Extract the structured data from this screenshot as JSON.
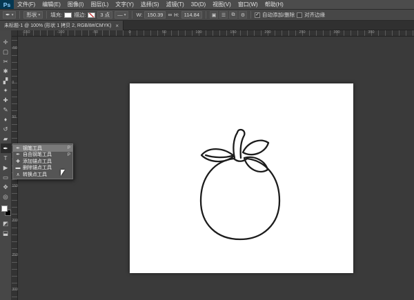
{
  "app": {
    "logo": "Ps",
    "menus": [
      {
        "label": "文件(F)"
      },
      {
        "label": "编辑(E)"
      },
      {
        "label": "图像(I)"
      },
      {
        "label": "图层(L)"
      },
      {
        "label": "文字(Y)"
      },
      {
        "label": "选择(S)"
      },
      {
        "label": "滤镜(T)"
      },
      {
        "label": "3D(D)"
      },
      {
        "label": "视图(V)"
      },
      {
        "label": "窗口(W)"
      },
      {
        "label": "帮助(H)"
      }
    ]
  },
  "icons": {
    "caret_down": "▾",
    "check": "✓",
    "close": "×",
    "link": "∞",
    "line_sample": "—"
  },
  "options": {
    "tool_icon": "✒",
    "mode": "形状",
    "fill_label": "填充:",
    "stroke_label": "描边:",
    "stroke_width": "3 点",
    "w_label": "W:",
    "w_value": "150.39",
    "h_label": "H:",
    "h_value": "114.84",
    "auto_add_delete": "自动添加/删除",
    "align_edges": "对齐边缘",
    "op_icons": [
      {
        "name": "path-operations-icon",
        "glyph": "▣"
      },
      {
        "name": "path-alignment-icon",
        "glyph": "☰"
      },
      {
        "name": "path-arrangement-icon",
        "glyph": "⧉"
      },
      {
        "name": "tool-settings-gear-icon",
        "glyph": "⚙"
      }
    ]
  },
  "tab": {
    "title": "未标题-1 @ 100% (形状 1 拷贝 2, RGB/8#/CMYK)",
    "close": "×"
  },
  "toolbar": {
    "tools": [
      {
        "name": "move-tool",
        "glyph": "✛"
      },
      {
        "name": "marquee-tool",
        "glyph": "▢"
      },
      {
        "name": "lasso-tool",
        "glyph": "✂"
      },
      {
        "name": "quick-selection-tool",
        "glyph": "✱"
      },
      {
        "name": "crop-tool",
        "glyph": "▞"
      },
      {
        "name": "eyedropper-tool",
        "glyph": "✦"
      },
      {
        "name": "healing-brush-tool",
        "glyph": "✚"
      },
      {
        "name": "brush-tool",
        "glyph": "✎"
      },
      {
        "name": "clone-stamp-tool",
        "glyph": "♦"
      },
      {
        "name": "history-brush-tool",
        "glyph": "↺"
      },
      {
        "name": "eraser-tool",
        "glyph": "▰"
      },
      {
        "name": "pen-tool",
        "glyph": "✒",
        "selected": true
      },
      {
        "name": "type-tool",
        "glyph": "T"
      },
      {
        "name": "path-selection-tool",
        "glyph": "▶"
      },
      {
        "name": "shape-tool",
        "glyph": "▭"
      },
      {
        "name": "hand-tool",
        "glyph": "✥"
      },
      {
        "name": "zoom-tool",
        "glyph": "◎"
      }
    ],
    "extras": [
      {
        "name": "quick-mask-button",
        "glyph": "◩"
      },
      {
        "name": "screen-mode-button",
        "glyph": "⬓"
      }
    ]
  },
  "flyout": {
    "items": [
      {
        "glyph": "✒",
        "label": "钢笔工具",
        "shortcut": "P",
        "selected": true
      },
      {
        "glyph": "✒",
        "label": "自由钢笔工具",
        "shortcut": "P"
      },
      {
        "glyph": "✚",
        "label": "添加锚点工具",
        "shortcut": ""
      },
      {
        "glyph": "▬",
        "label": "删除锚点工具",
        "shortcut": ""
      },
      {
        "glyph": "∧",
        "label": "转换点工具",
        "shortcut": ""
      }
    ]
  },
  "rulers": {
    "h_labels": [
      "-150",
      "-100",
      "-50",
      "0",
      "50",
      "100",
      "150",
      "200",
      "250",
      "300",
      "350"
    ],
    "v_labels": [
      "-50",
      "0",
      "50",
      "100",
      "150",
      "200",
      "250",
      "300"
    ]
  }
}
